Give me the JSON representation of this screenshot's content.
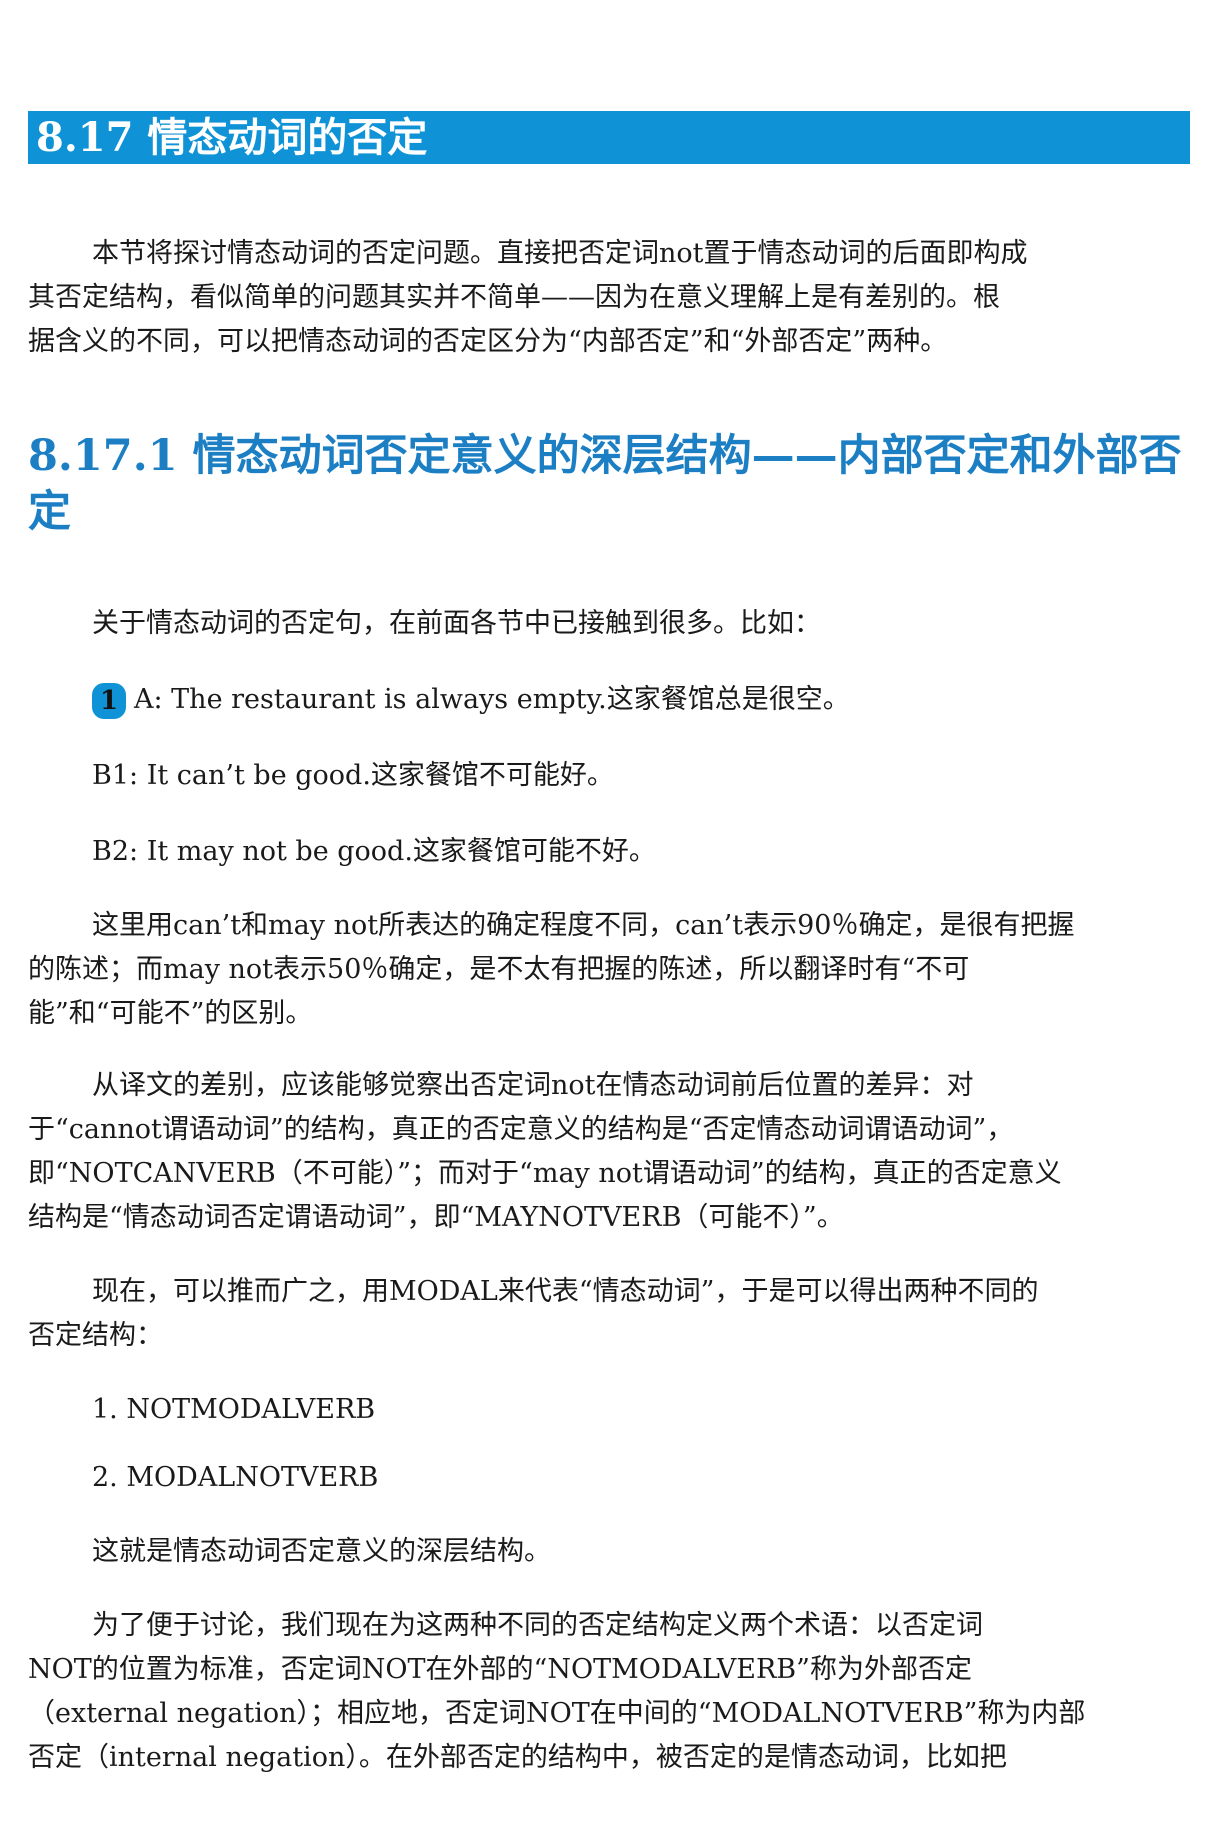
{
  "section": {
    "title": "8.17 情态动词的否定"
  },
  "intro": {
    "lines": [
      "本节将探讨情态动词的否定问题。直接把否定词not置于情态动词的后面即构成",
      "其否定结构，看似简单的问题其实并不简单——因为在意义理解上是有差别的。根",
      "据含义的不同，可以把情态动词的否定区分为“内部否定”和“外部否定”两种。"
    ]
  },
  "subsection": {
    "title_lines": [
      "8.17.1 情态动词否定意义的深层结构——内部否定和外部否",
      "定"
    ]
  },
  "para1": {
    "text": "关于情态动词的否定句，在前面各节中已接触到很多。比如："
  },
  "example1": {
    "number": "1",
    "a": "A: The restaurant is always empty.这家餐馆总是很空。",
    "b1": "B1: It can’t be good.这家餐馆不可能好。",
    "b2": "B2: It may not be good.这家餐馆可能不好。"
  },
  "para2": {
    "lines": [
      "这里用can’t和may not所表达的确定程度不同，can’t表示90％确定，是很有把握",
      "的陈述；而may not表示50％确定，是不太有把握的陈述，所以翻译时有“不可",
      "能”和“可能不”的区别。"
    ]
  },
  "para3": {
    "lines": [
      "从译文的差别，应该能够觉察出否定词not在情态动词前后位置的差异：对",
      "于“cannot谓语动词”的结构，真正的否定意义的结构是“否定情态动词谓语动词”，",
      "即“NOTCANVERB（不可能）”；而对于“may not谓语动词”的结构，真正的否定意义",
      "结构是“情态动词否定谓语动词”，即“MAYNOTVERB（可能不）”。"
    ]
  },
  "para4": {
    "lines": [
      "现在，可以推而广之，用MODAL来代表“情态动词”，于是可以得出两种不同的",
      "否定结构："
    ]
  },
  "list": {
    "item1": "1. NOTMODALVERB",
    "item2": "2. MODALNOTVERB"
  },
  "para5": {
    "text": "这就是情态动词否定意义的深层结构。"
  },
  "para6": {
    "lines": [
      "为了便于讨论，我们现在为这两种不同的否定结构定义两个术语：以否定词",
      "NOT的位置为标准，否定词NOT在外部的“NOTMODALVERB”称为外部否定",
      "（external negation）；相应地，否定词NOT在中间的“MODALNOTVERB”称为内部",
      "否定（internal negation）。在外部否定的结构中，被否定的是情态动词，比如把"
    ]
  },
  "colors": {
    "banner_bg": "#0f93d6",
    "subsection_text": "#1c7fc4"
  }
}
